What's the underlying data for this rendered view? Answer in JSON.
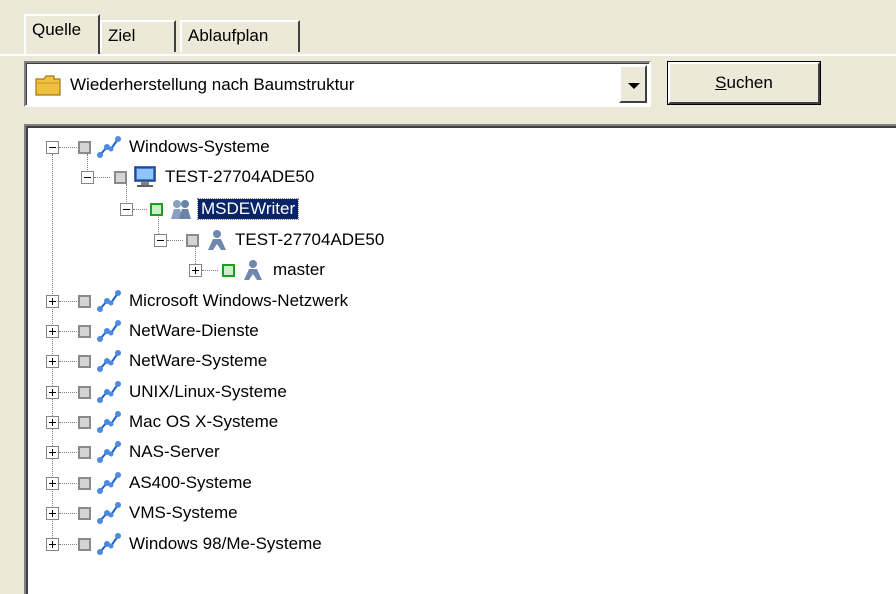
{
  "tabs": [
    {
      "label": "Quelle",
      "active": true
    },
    {
      "label": "Ziel",
      "active": false
    },
    {
      "label": "Ablaufplan",
      "active": false
    }
  ],
  "source_combo": {
    "value": "Wiederherstellung nach Baumstruktur",
    "icon": "folder-icon"
  },
  "search_button": {
    "label_accel": "S",
    "label_rest": "uchen"
  },
  "tree": {
    "windows_systems": "Windows-Systeme",
    "test_machine": "TEST-27704ADE50",
    "msde_writer": "MSDEWriter",
    "test_instance": "TEST-27704ADE50",
    "master": "master",
    "others": [
      "Microsoft Windows-Netzwerk",
      "NetWare-Dienste",
      "NetWare-Systeme",
      "UNIX/Linux-Systeme",
      "Mac OS X-Systeme",
      "NAS-Server",
      "AS400-Systeme",
      "VMS-Systeme",
      "Windows 98/Me-Systeme"
    ]
  },
  "colors": {
    "selection": "#0a246a",
    "checked_green": "#1aa01a",
    "window_bg": "#ece9d8"
  }
}
